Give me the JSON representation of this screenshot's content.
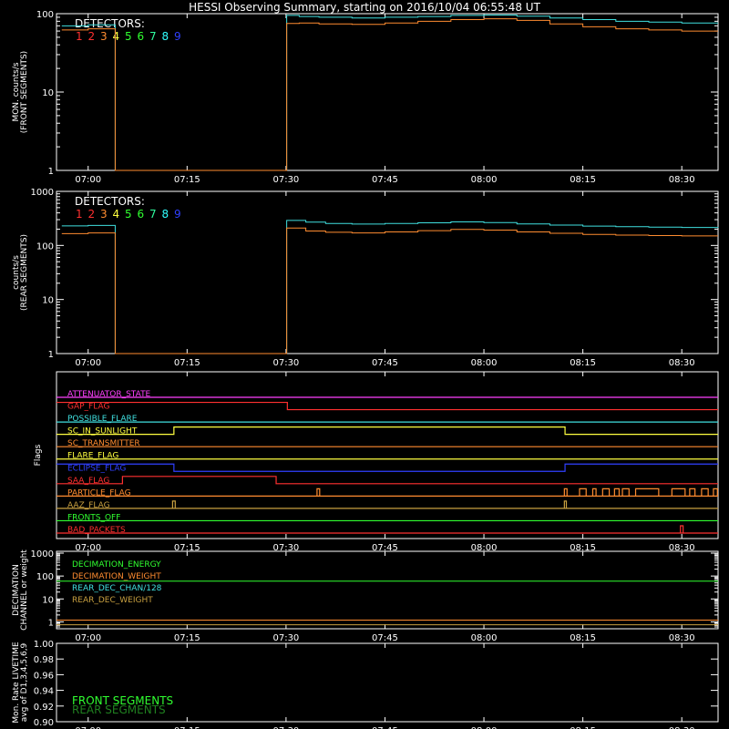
{
  "title": "HESSI Observing Summary, starting on 2016/10/04 06:55:48 UT",
  "colors": {
    "frame": "#ffffff",
    "det": [
      "#ff3030",
      "#ff3030",
      "#ff8c30",
      "#ffff40",
      "#30ff30",
      "#30ff30",
      "#30ffa0",
      "#30ffff",
      "#3040ff"
    ],
    "trace_cyan": "#40e0e0",
    "trace_orange": "#ff8c30"
  },
  "time_axis": {
    "start_min": -4.8,
    "end_min": 95.5,
    "tick_values": [
      0,
      15,
      30,
      45,
      60,
      75,
      90
    ],
    "tick_labels": [
      "07:00",
      "07:15",
      "07:30",
      "07:45",
      "08:00",
      "08:15",
      "08:30"
    ]
  },
  "chart_data": [
    {
      "type": "line",
      "panel": "front",
      "ylabel_lines": [
        "MON. counts/s",
        "(FRONT SEGMENTS)"
      ],
      "yscale": "log",
      "ylim": [
        1,
        100
      ],
      "y_tick_values": [
        1,
        10,
        100
      ],
      "y_tick_labels": [
        "1",
        "10",
        "100"
      ],
      "legend_title": "DETECTORS:",
      "legend_numbers": [
        "1",
        "2",
        "3",
        "4",
        "5",
        "6",
        "7",
        "8",
        "9"
      ],
      "series": [
        {
          "color": "cyan",
          "x": [
            -4.0,
            0,
            4,
            4.1,
            30,
            30.1,
            32,
            35,
            40,
            45,
            50,
            55,
            60,
            65,
            70,
            75,
            80,
            85,
            90,
            95.5
          ],
          "y": [
            70,
            72,
            72,
            1,
            1,
            95,
            92,
            90,
            88,
            90,
            92,
            95,
            96,
            93,
            88,
            84,
            80,
            78,
            76,
            76
          ]
        },
        {
          "color": "orange",
          "x": [
            -4.0,
            0,
            4,
            4.1,
            30,
            30.1,
            32,
            35,
            40,
            45,
            50,
            55,
            60,
            65,
            70,
            75,
            80,
            85,
            90,
            95.5
          ],
          "y": [
            62,
            64,
            64,
            1,
            1,
            75,
            76,
            74,
            73,
            76,
            80,
            84,
            86,
            82,
            74,
            68,
            64,
            62,
            60,
            60
          ]
        }
      ]
    },
    {
      "type": "line",
      "panel": "rear",
      "ylabel_lines": [
        "counts/s",
        "(REAR SEGMENTS)"
      ],
      "yscale": "log",
      "ylim": [
        1,
        1000
      ],
      "y_tick_values": [
        1,
        10,
        100,
        1000
      ],
      "y_tick_labels": [
        "1",
        "10",
        "100",
        "1000"
      ],
      "legend_title": "DETECTORS:",
      "legend_numbers": [
        "1",
        "2",
        "3",
        "4",
        "5",
        "6",
        "7",
        "8",
        "9"
      ],
      "series": [
        {
          "color": "cyan",
          "x": [
            -4.0,
            0,
            4,
            4.1,
            30,
            30.1,
            33,
            36,
            40,
            45,
            50,
            55,
            60,
            65,
            70,
            75,
            80,
            85,
            90,
            95.5
          ],
          "y": [
            230,
            235,
            235,
            1,
            1,
            290,
            270,
            255,
            248,
            255,
            262,
            272,
            265,
            250,
            238,
            228,
            222,
            218,
            215,
            212
          ]
        },
        {
          "color": "orange",
          "x": [
            -4.0,
            0,
            4,
            4.1,
            30,
            30.1,
            33,
            36,
            40,
            45,
            50,
            55,
            60,
            65,
            70,
            75,
            80,
            85,
            90,
            95.5
          ],
          "y": [
            165,
            170,
            170,
            1,
            1,
            210,
            185,
            175,
            170,
            178,
            188,
            198,
            192,
            178,
            168,
            160,
            155,
            152,
            150,
            150
          ]
        }
      ]
    },
    {
      "type": "line",
      "panel": "flags",
      "ylabel": "Flags",
      "flags": [
        {
          "name": "ATTENUATOR_STATE",
          "color": "#ff40ff",
          "segments": [
            [
              -4.8,
              95.5,
              0
            ]
          ]
        },
        {
          "name": "GAP_FLAG",
          "color": "#ff3030",
          "segments": [
            [
              -4.8,
              30.2,
              1
            ],
            [
              30.2,
              95.5,
              0
            ]
          ]
        },
        {
          "name": "POSSIBLE_FLARE",
          "color": "#40e0e0",
          "segments": [
            [
              -4.8,
              95.5,
              0
            ]
          ]
        },
        {
          "name": "SC_IN_SUNLIGHT",
          "color": "#ffff40",
          "segments": [
            [
              -4.8,
              13,
              0
            ],
            [
              13,
              72.3,
              1
            ],
            [
              72.3,
              95.5,
              0
            ]
          ]
        },
        {
          "name": "SC_TRANSMITTER",
          "color": "#ff8c30",
          "segments": [
            [
              -4.8,
              95.5,
              0
            ]
          ]
        },
        {
          "name": "FLARE_FLAG",
          "color": "#ffff40",
          "segments": [
            [
              -4.8,
              95.5,
              0
            ]
          ]
        },
        {
          "name": "ECLIPSE_FLAG",
          "color": "#3040ff",
          "segments": [
            [
              -4.8,
              13,
              1
            ],
            [
              13,
              72.3,
              0
            ],
            [
              72.3,
              95.5,
              1
            ]
          ]
        },
        {
          "name": "SAA_FLAG",
          "color": "#ff3030",
          "segments": [
            [
              -4.8,
              5.2,
              0
            ],
            [
              5.2,
              28.5,
              1
            ],
            [
              28.5,
              95.5,
              0
            ]
          ]
        },
        {
          "name": "PARTICLE_FLAG",
          "color": "#ff8c30",
          "segments": [
            [
              -4.8,
              95.5,
              0
            ]
          ],
          "spikes": [
            [
              34.7,
              35.1
            ],
            [
              72.2,
              72.6
            ],
            [
              74.5,
              75.5
            ],
            [
              76.5,
              77
            ],
            [
              78,
              79
            ],
            [
              79.8,
              80.5
            ],
            [
              81,
              82
            ],
            [
              83,
              86.5
            ],
            [
              88.5,
              90.5
            ],
            [
              91.2,
              92
            ],
            [
              93,
              94
            ],
            [
              94.8,
              95.4
            ]
          ]
        },
        {
          "name": "AAZ_FLAG",
          "color": "#c8a040",
          "segments": [
            [
              -4.8,
              95.5,
              0
            ]
          ],
          "spikes": [
            [
              12.8,
              13.2
            ],
            [
              72.2,
              72.5
            ]
          ]
        },
        {
          "name": "FRONTS_OFF",
          "color": "#30ff30",
          "segments": [
            [
              -4.8,
              95.5,
              0
            ]
          ]
        },
        {
          "name": "BAD_PACKETS",
          "color": "#ff3030",
          "segments": [
            [
              -4.8,
              95.5,
              0
            ]
          ],
          "spikes": [
            [
              89.8,
              90.2
            ]
          ]
        }
      ]
    },
    {
      "type": "line",
      "panel": "decimation",
      "ylabel_lines": [
        "DECIMATION",
        "CHANNEL or weight"
      ],
      "yscale": "log",
      "ylim": [
        0.5,
        1200
      ],
      "y_tick_values": [
        1,
        10,
        100,
        1000
      ],
      "y_tick_labels": [
        "1",
        "10",
        "100",
        "1000"
      ],
      "legend": [
        {
          "name": "DECIMATION_ENERGY",
          "color": "#30ff30"
        },
        {
          "name": "DECIMATION_WEIGHT",
          "color": "#ff8c30"
        },
        {
          "name": "REAR_DEC_CHAN/128",
          "color": "#40e0e0"
        },
        {
          "name": "REAR_DEC_WEIGHT",
          "color": "#c8a040"
        }
      ],
      "series": [
        {
          "color": "#30ff30",
          "x": [
            -4.8,
            95.5
          ],
          "y": [
            60,
            60
          ]
        },
        {
          "color": "#ff8c30",
          "x": [
            -4.8,
            95.5
          ],
          "y": [
            1.2,
            1.2
          ]
        },
        {
          "color": "#c8a040",
          "x": [
            -4.8,
            95.5
          ],
          "y": [
            0.75,
            0.75
          ]
        }
      ]
    },
    {
      "type": "line",
      "panel": "livetime",
      "ylabel_lines": [
        "Mon. Rate LIVETIME",
        "avg of D1,3,4,5,6,9"
      ],
      "ylim": [
        0.9,
        1.0
      ],
      "y_tick_values": [
        0.9,
        0.92,
        0.94,
        0.96,
        0.98,
        1.0
      ],
      "y_tick_labels": [
        "0.90",
        "0.92",
        "0.94",
        "0.96",
        "0.98",
        "1.00"
      ],
      "legend": [
        {
          "name": "FRONT SEGMENTS",
          "color": "#30ff30"
        },
        {
          "name": "REAR SEGMENTS",
          "color": "#208020"
        }
      ],
      "series": []
    }
  ]
}
